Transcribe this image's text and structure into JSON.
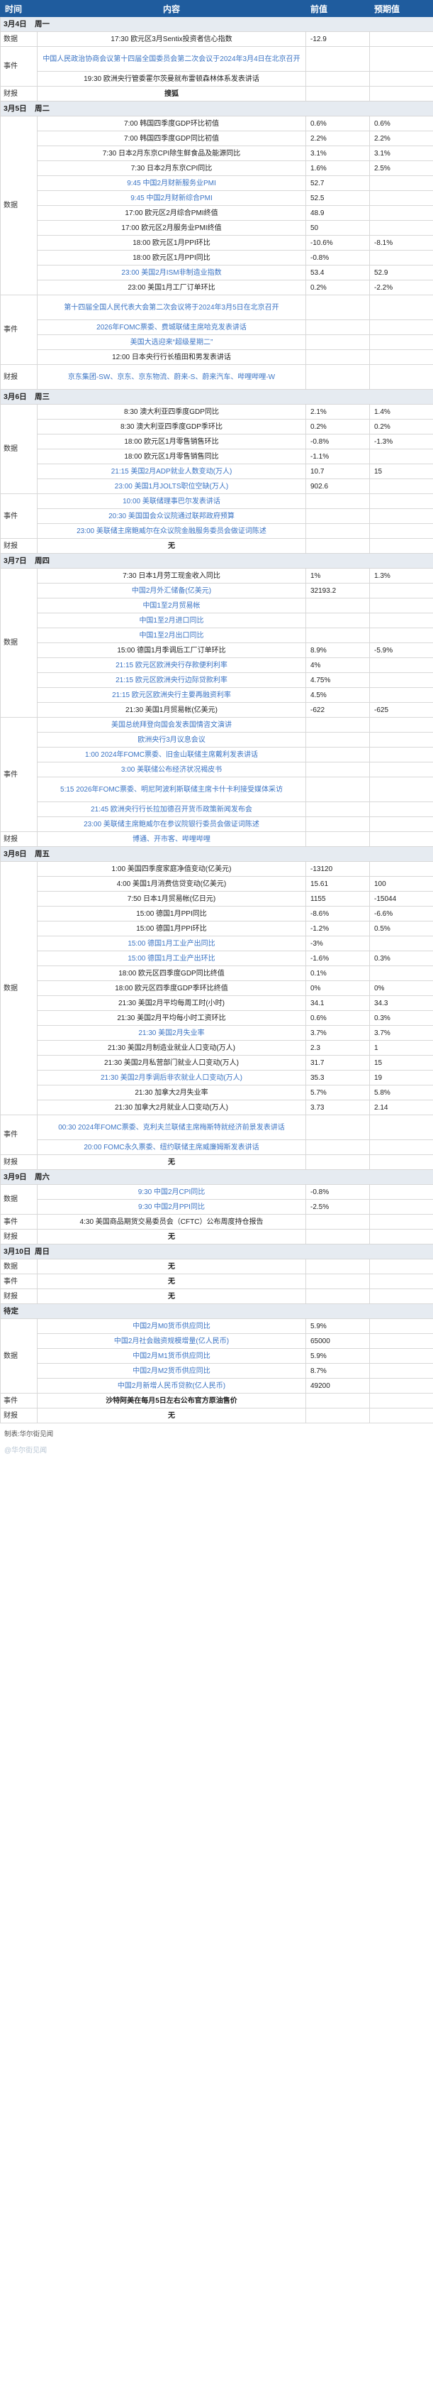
{
  "header": {
    "time": "时间",
    "content": "内容",
    "previous": "前值",
    "forecast": "预期值"
  },
  "days": [
    {
      "date": "3月4日",
      "weekday": "周一",
      "groups": [
        {
          "category": "数据",
          "rows": [
            {
              "text": "17:30 欧元区3月Sentix投资者信心指数",
              "prev": "-12.9",
              "fc": "",
              "link": false
            }
          ]
        },
        {
          "category": "事件",
          "rows": [
            {
              "text": "中国人民政治协商会议第十四届全国委员会第二次会议于2024年3月4日在北京召开",
              "prev": "",
              "fc": "",
              "link": true,
              "tall": true
            },
            {
              "text": "19:30 欧洲央行管委霍尔茨曼就布雷顿森林体系发表讲话",
              "prev": "",
              "fc": "",
              "link": false
            }
          ]
        },
        {
          "category": "财报",
          "rows": [
            {
              "text": "搜狐",
              "prev": "",
              "fc": "",
              "link": false,
              "bold": true
            }
          ]
        }
      ]
    },
    {
      "date": "3月5日",
      "weekday": "周二",
      "groups": [
        {
          "category": "数据",
          "rows": [
            {
              "text": "7:00 韩国四季度GDP环比初值",
              "prev": "0.6%",
              "fc": "0.6%",
              "link": false
            },
            {
              "text": "7:00 韩国四季度GDP同比初值",
              "prev": "2.2%",
              "fc": "2.2%",
              "link": false
            },
            {
              "text": "7:30 日本2月东京CPI除生鲜食品及能源同比",
              "prev": "3.1%",
              "fc": "3.1%",
              "link": false
            },
            {
              "text": "7:30 日本2月东京CPI同比",
              "prev": "1.6%",
              "fc": "2.5%",
              "link": false
            },
            {
              "text": "9:45 中国2月财新服务业PMI",
              "prev": "52.7",
              "fc": "",
              "link": true
            },
            {
              "text": "9:45 中国2月财新综合PMI",
              "prev": "52.5",
              "fc": "",
              "link": true
            },
            {
              "text": "17:00 欧元区2月综合PMI终值",
              "prev": "48.9",
              "fc": "",
              "link": false
            },
            {
              "text": "17:00 欧元区2月服务业PMI终值",
              "prev": "50",
              "fc": "",
              "link": false
            },
            {
              "text": "18:00 欧元区1月PPI环比",
              "prev": "-10.6%",
              "fc": "-8.1%",
              "link": false
            },
            {
              "text": "18:00 欧元区1月PPI同比",
              "prev": "-0.8%",
              "fc": "",
              "link": false
            },
            {
              "text": "23:00 美国2月ISM非制造业指数",
              "prev": "53.4",
              "fc": "52.9",
              "link": true
            },
            {
              "text": "23:00 美国1月工厂订单环比",
              "prev": "0.2%",
              "fc": "-2.2%",
              "link": false
            }
          ]
        },
        {
          "category": "事件",
          "rows": [
            {
              "text": "第十四届全国人民代表大会第二次会议将于2024年3月5日在北京召开",
              "prev": "",
              "fc": "",
              "link": true,
              "tall": true
            },
            {
              "text": "2026年FOMC票委、费城联储主席哈克发表讲话",
              "prev": "",
              "fc": "",
              "link": true
            },
            {
              "text": "美国大选迎来“超级星期二”",
              "prev": "",
              "fc": "",
              "link": true
            },
            {
              "text": "12:00 日本央行行长植田和男发表讲话",
              "prev": "",
              "fc": "",
              "link": false
            }
          ]
        },
        {
          "category": "财报",
          "rows": [
            {
              "text": "京东集团-SW、京东、京东物流、蔚来-S、蔚来汽车、哔哩哔哩-W",
              "prev": "",
              "fc": "",
              "link": true,
              "tall": true
            }
          ]
        }
      ]
    },
    {
      "date": "3月6日",
      "weekday": "周三",
      "groups": [
        {
          "category": "数据",
          "rows": [
            {
              "text": "8:30 澳大利亚四季度GDP同比",
              "prev": "2.1%",
              "fc": "1.4%",
              "link": false
            },
            {
              "text": "8:30 澳大利亚四季度GDP季环比",
              "prev": "0.2%",
              "fc": "0.2%",
              "link": false
            },
            {
              "text": "18:00 欧元区1月零售销售环比",
              "prev": "-0.8%",
              "fc": "-1.3%",
              "link": false
            },
            {
              "text": "18:00 欧元区1月零售销售同比",
              "prev": "-1.1%",
              "fc": "",
              "link": false
            },
            {
              "text": "21:15 美国2月ADP就业人数变动(万人)",
              "prev": "10.7",
              "fc": "15",
              "link": true
            },
            {
              "text": "23:00 美国1月JOLTS职位空缺(万人)",
              "prev": "902.6",
              "fc": "",
              "link": true
            }
          ]
        },
        {
          "category": "事件",
          "rows": [
            {
              "text": "10:00 美联储理事巴尔发表讲话",
              "prev": "",
              "fc": "",
              "link": true
            },
            {
              "text": "20:30 美国国会众议院通过联邦政府预算",
              "prev": "",
              "fc": "",
              "link": true
            },
            {
              "text": "23:00 美联储主席鲍威尔在众议院金融服务委员会做证词陈述",
              "prev": "",
              "fc": "",
              "link": true
            }
          ]
        },
        {
          "category": "财报",
          "rows": [
            {
              "text": "无",
              "prev": "",
              "fc": "",
              "link": false,
              "bold": true
            }
          ]
        }
      ]
    },
    {
      "date": "3月7日",
      "weekday": "周四",
      "groups": [
        {
          "category": "数据",
          "rows": [
            {
              "text": "7:30 日本1月劳工现金收入同比",
              "prev": "1%",
              "fc": "1.3%",
              "link": false
            },
            {
              "text": "中国2月外汇储备(亿美元)",
              "prev": "32193.2",
              "fc": "",
              "link": true
            },
            {
              "text": "中国1至2月贸易帐",
              "prev": "",
              "fc": "",
              "link": true
            },
            {
              "text": "中国1至2月进口同比",
              "prev": "",
              "fc": "",
              "link": true
            },
            {
              "text": "中国1至2月出口同比",
              "prev": "",
              "fc": "",
              "link": true
            },
            {
              "text": "15:00 德国1月季调后工厂订单环比",
              "prev": "8.9%",
              "fc": "-5.9%",
              "link": false
            },
            {
              "text": "21:15 欧元区欧洲央行存款便利利率",
              "prev": "4%",
              "fc": "",
              "link": true
            },
            {
              "text": "21:15 欧元区欧洲央行边际贷款利率",
              "prev": "4.75%",
              "fc": "",
              "link": true
            },
            {
              "text": "21:15 欧元区欧洲央行主要再融资利率",
              "prev": "4.5%",
              "fc": "",
              "link": true
            },
            {
              "text": "21:30 美国1月贸易帐(亿美元)",
              "prev": "-622",
              "fc": "-625",
              "link": false
            }
          ]
        },
        {
          "category": "事件",
          "rows": [
            {
              "text": "美国总统拜登向国会发表国情咨文演讲",
              "prev": "",
              "fc": "",
              "link": true
            },
            {
              "text": "欧洲央行3月议息会议",
              "prev": "",
              "fc": "",
              "link": true
            },
            {
              "text": "1:00 2024年FOMC票委、旧金山联储主席戴利发表讲话",
              "prev": "",
              "fc": "",
              "link": true
            },
            {
              "text": "3:00 美联储公布经济状况褐皮书",
              "prev": "",
              "fc": "",
              "link": true
            },
            {
              "text": "5:15 2026年FOMC票委、明尼阿波利斯联储主席卡什卡利接受媒体采访",
              "prev": "",
              "fc": "",
              "link": true,
              "tall": true
            },
            {
              "text": "21:45 欧洲央行行长拉加德召开货币政策新闻发布会",
              "prev": "",
              "fc": "",
              "link": true
            },
            {
              "text": "23:00 美联储主席鲍威尔在参议院银行委员会做证词陈述",
              "prev": "",
              "fc": "",
              "link": true
            }
          ]
        },
        {
          "category": "财报",
          "rows": [
            {
              "text": "博通、开市客、哔哩哔哩",
              "prev": "",
              "fc": "",
              "link": true
            }
          ]
        }
      ]
    },
    {
      "date": "3月8日",
      "weekday": "周五",
      "groups": [
        {
          "category": "数据",
          "rows": [
            {
              "text": "1:00 美国四季度家庭净值变动(亿美元)",
              "prev": "-13120",
              "fc": "",
              "link": false
            },
            {
              "text": "4:00 美国1月消费信贷变动(亿美元)",
              "prev": "15.61",
              "fc": "100",
              "link": false
            },
            {
              "text": "7:50 日本1月贸易帐(亿日元)",
              "prev": "1155",
              "fc": "-15044",
              "link": false
            },
            {
              "text": "15:00 德国1月PPI同比",
              "prev": "-8.6%",
              "fc": "-6.6%",
              "link": false
            },
            {
              "text": "15:00 德国1月PPI环比",
              "prev": "-1.2%",
              "fc": "0.5%",
              "link": false
            },
            {
              "text": "15:00 德国1月工业产出同比",
              "prev": "-3%",
              "fc": "",
              "link": true
            },
            {
              "text": "15:00 德国1月工业产出环比",
              "prev": "-1.6%",
              "fc": "0.3%",
              "link": true
            },
            {
              "text": "18:00 欧元区四季度GDP同比终值",
              "prev": "0.1%",
              "fc": "",
              "link": false
            },
            {
              "text": "18:00 欧元区四季度GDP季环比终值",
              "prev": "0%",
              "fc": "0%",
              "link": false
            },
            {
              "text": "21:30 美国2月平均每周工时(小时)",
              "prev": "34.1",
              "fc": "34.3",
              "link": false
            },
            {
              "text": "21:30 美国2月平均每小时工资环比",
              "prev": "0.6%",
              "fc": "0.3%",
              "link": false
            },
            {
              "text": "21:30 美国2月失业率",
              "prev": "3.7%",
              "fc": "3.7%",
              "link": true
            },
            {
              "text": "21:30 美国2月制造业就业人口变动(万人)",
              "prev": "2.3",
              "fc": "1",
              "link": false
            },
            {
              "text": "21:30 美国2月私营部门就业人口变动(万人)",
              "prev": "31.7",
              "fc": "15",
              "link": false
            },
            {
              "text": "21:30 美国2月季调后非农就业人口变动(万人)",
              "prev": "35.3",
              "fc": "19",
              "link": true
            },
            {
              "text": "21:30 加拿大2月失业率",
              "prev": "5.7%",
              "fc": "5.8%",
              "link": false
            },
            {
              "text": "21:30 加拿大2月就业人口变动(万人)",
              "prev": "3.73",
              "fc": "2.14",
              "link": false
            }
          ]
        },
        {
          "category": "事件",
          "rows": [
            {
              "text": "00:30 2024年FOMC票委、克利夫兰联储主席梅斯特就经济前景发表讲话",
              "prev": "",
              "fc": "",
              "link": true,
              "tall": true
            },
            {
              "text": "20:00 FOMC永久票委、纽约联储主席威廉姆斯发表讲话",
              "prev": "",
              "fc": "",
              "link": true
            }
          ]
        },
        {
          "category": "财报",
          "rows": [
            {
              "text": "无",
              "prev": "",
              "fc": "",
              "link": false,
              "bold": true
            }
          ]
        }
      ]
    },
    {
      "date": "3月9日",
      "weekday": "周六",
      "groups": [
        {
          "category": "数据",
          "rows": [
            {
              "text": "9:30 中国2月CPI同比",
              "prev": "-0.8%",
              "fc": "",
              "link": true
            },
            {
              "text": "9:30 中国2月PPI同比",
              "prev": "-2.5%",
              "fc": "",
              "link": true
            }
          ]
        },
        {
          "category": "事件",
          "rows": [
            {
              "text": "4:30 美国商品期货交易委员会（CFTC）公布周度持仓报告",
              "prev": "",
              "fc": "",
              "link": false
            }
          ]
        },
        {
          "category": "财报",
          "rows": [
            {
              "text": "无",
              "prev": "",
              "fc": "",
              "link": false,
              "bold": true
            }
          ]
        }
      ]
    },
    {
      "date": "3月10日",
      "weekday": "周日",
      "groups": [
        {
          "category": "数据",
          "rows": [
            {
              "text": "无",
              "prev": "",
              "fc": "",
              "link": false,
              "bold": true
            }
          ]
        },
        {
          "category": "事件",
          "rows": [
            {
              "text": "无",
              "prev": "",
              "fc": "",
              "link": false,
              "bold": true
            }
          ]
        },
        {
          "category": "财报",
          "rows": [
            {
              "text": "无",
              "prev": "",
              "fc": "",
              "link": false,
              "bold": true
            }
          ]
        }
      ]
    },
    {
      "date": "待定",
      "weekday": "",
      "groups": [
        {
          "category": "数据",
          "rows": [
            {
              "text": "中国2月M0货币供应同比",
              "prev": "5.9%",
              "fc": "",
              "link": true
            },
            {
              "text": "中国2月社会融资规模增量(亿人民币)",
              "prev": "65000",
              "fc": "",
              "link": true
            },
            {
              "text": "中国2月M1货币供应同比",
              "prev": "5.9%",
              "fc": "",
              "link": true
            },
            {
              "text": "中国2月M2货币供应同比",
              "prev": "8.7%",
              "fc": "",
              "link": true
            },
            {
              "text": "中国2月新增人民币贷款(亿人民币)",
              "prev": "49200",
              "fc": "",
              "link": true
            }
          ]
        },
        {
          "category": "事件",
          "rows": [
            {
              "text": "沙特阿美在每月5日左右公布官方原油售价",
              "prev": "",
              "fc": "",
              "link": false,
              "bold": true
            }
          ]
        },
        {
          "category": "财报",
          "rows": [
            {
              "text": "无",
              "prev": "",
              "fc": "",
              "link": false,
              "bold": true
            }
          ]
        }
      ]
    }
  ],
  "footer": {
    "source": "制表:华尔街见闻",
    "watermark": "@华尔街见闻"
  },
  "colors": {
    "header_bg": "#1f5c9e",
    "day_bg": "#e6ebf1",
    "link": "#3b74c4",
    "border": "#d8d8d8"
  }
}
